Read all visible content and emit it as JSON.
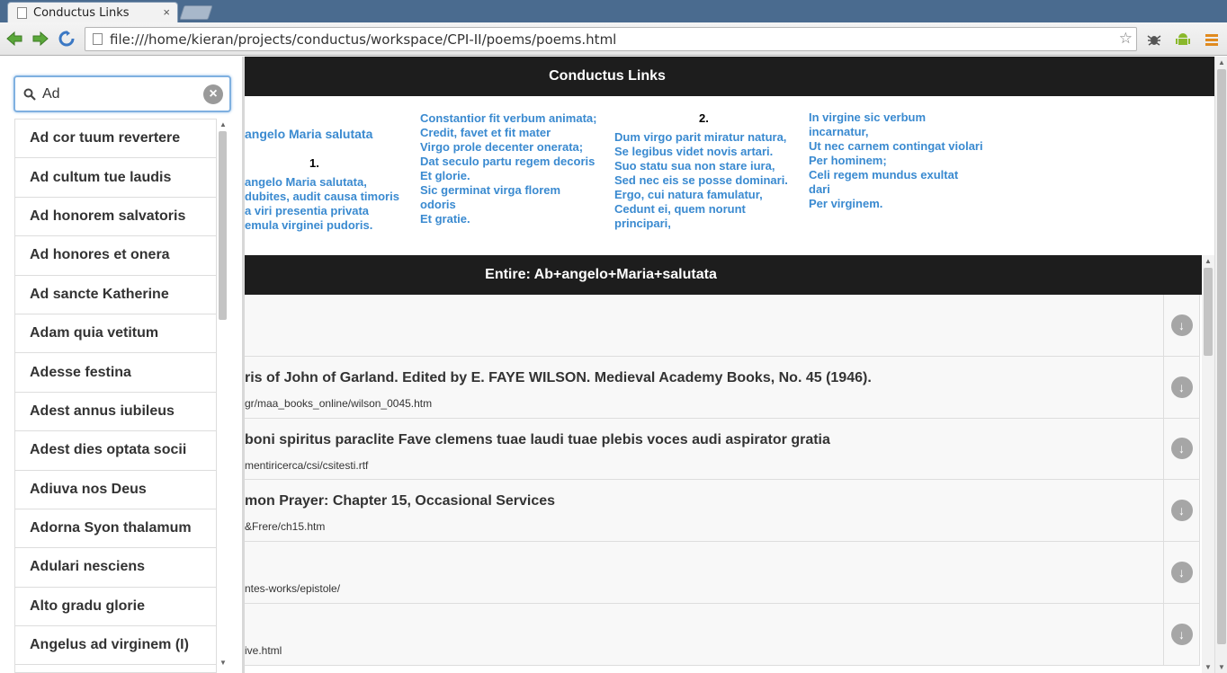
{
  "browser": {
    "tab_title": "Conductus Links",
    "tab_close": "×",
    "url": "file:///home/kieran/projects/conductus/workspace/CPI-II/poems/poems.html"
  },
  "search": {
    "value": "Ad",
    "clear_glyph": "×"
  },
  "results_list": [
    "Ad cor tuum revertere",
    "Ad cultum tue laudis",
    "Ad honorem salvatoris",
    "Ad honores et onera",
    "Ad sancte Katherine",
    "Adam quia vetitum",
    "Adesse festina",
    "Adest annus iubileus",
    "Adest dies optata socii",
    "Adiuva nos Deus",
    "Adorna Syon thalamum",
    "Adulari nesciens",
    "Alto gradu glorie",
    "Angelus ad virginem (I)"
  ],
  "page": {
    "header": "Conductus Links",
    "poem_title": "angelo Maria salutata",
    "stanza1_num": "1.",
    "stanza1": [
      "angelo Maria salutata,",
      "dubites, audit causa timoris",
      "a viri presentia privata",
      "emula virginei pudoris."
    ],
    "stanza1b": [
      "Constantior fit verbum animata;",
      "Credit, favet et fit mater",
      "Virgo prole decenter onerata;",
      "Dat seculo partu regem decoris",
      "Et glorie.",
      "Sic germinat virga florem",
      "odoris",
      "Et gratie."
    ],
    "stanza2_num": "2.",
    "stanza2": [
      "Dum virgo parit miratur natura,",
      "Se legibus videt novis artari.",
      "Suo statu sua non stare iura,",
      "Sed nec eis se posse dominari.",
      "Ergo, cui natura famulatur,",
      "Cedunt ei, quem norunt",
      "principari,"
    ],
    "stanza2b": [
      "In virgine sic verbum",
      "incarnatur,",
      "Ut nec carnem contingat violari",
      "Per hominem;",
      "Celi regem mundus exultat",
      "dari",
      "Per virginem."
    ],
    "entire_header": "Entire: Ab+angelo+Maria+salutata",
    "rows": [
      {
        "title": "",
        "url": ""
      },
      {
        "title": "ris of John of Garland. Edited by E. FAYE WILSON. Medieval Academy Books, No. 45 (1946).",
        "url": "gr/maa_books_online/wilson_0045.htm"
      },
      {
        "title": "boni spiritus paraclite Fave clemens tuae laudi tuae plebis voces audi aspirator gratia",
        "url": "mentiricerca/csi/csitesti.rtf"
      },
      {
        "title": "mon Prayer: Chapter 15, Occasional Services",
        "url": "&Frere/ch15.htm"
      },
      {
        "title": "",
        "url": "ntes-works/epistole/"
      },
      {
        "title": "",
        "url": "ive.html"
      }
    ],
    "download_glyph": "↓"
  },
  "colors": {
    "link_blue": "#3a8ad0",
    "bar_black": "#1d1d1d",
    "search_focus": "#7fb0e0"
  }
}
